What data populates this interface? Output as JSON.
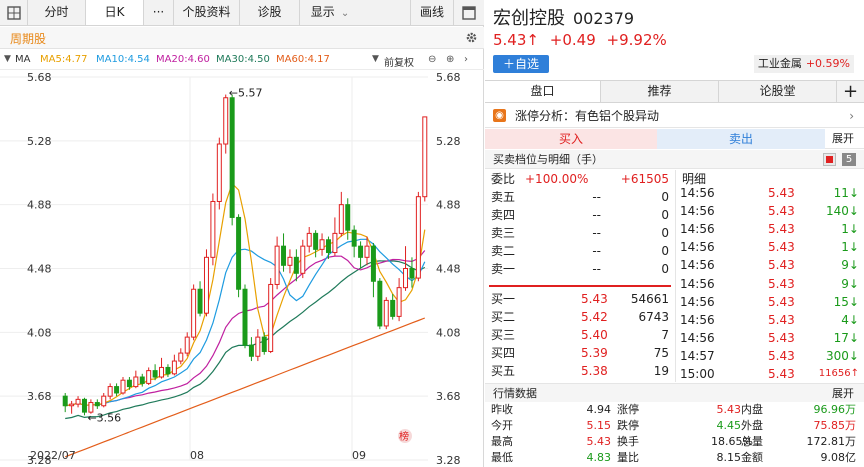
{
  "toolbar": {
    "fenshi": "分时",
    "rik": "日K",
    "more": "···",
    "ziliao": "个股资料",
    "zhengu": "诊股",
    "xianshi": "显示",
    "huaxian": "画线"
  },
  "subbar": {
    "zhouqi": "周期股"
  },
  "ma": {
    "label": "MA",
    "ma5": "MA5:4.77",
    "ma10": "MA10:4.54",
    "ma20": "MA20:4.60",
    "ma30": "MA30:4.50",
    "ma60": "MA60:4.17",
    "fuquan": "前复权"
  },
  "colors": {
    "up": "#e02020",
    "down": "#1a9a1a",
    "ma5": "#e8a000",
    "ma10": "#1e9be0",
    "ma20": "#c020a0",
    "ma30": "#1f7a5a",
    "ma60": "#e35d1a"
  },
  "chart_data": {
    "type": "candlestick",
    "y_ticks": [
      "5.68",
      "5.28",
      "4.88",
      "4.48",
      "4.08",
      "3.68",
      "3.28"
    ],
    "ylim": [
      3.28,
      5.68
    ],
    "x_labels": [
      "2022/07",
      "08",
      "09"
    ],
    "annotations": {
      "high": "←5.57",
      "low": "←3.56"
    },
    "candles": [
      [
        3.68,
        3.62,
        3.7,
        3.58
      ],
      [
        3.62,
        3.63,
        3.65,
        3.57
      ],
      [
        3.63,
        3.66,
        3.68,
        3.61
      ],
      [
        3.66,
        3.58,
        3.67,
        3.56
      ],
      [
        3.58,
        3.64,
        3.66,
        3.57
      ],
      [
        3.64,
        3.62,
        3.66,
        3.6
      ],
      [
        3.62,
        3.68,
        3.7,
        3.61
      ],
      [
        3.68,
        3.74,
        3.76,
        3.66
      ],
      [
        3.74,
        3.7,
        3.76,
        3.68
      ],
      [
        3.7,
        3.78,
        3.8,
        3.69
      ],
      [
        3.78,
        3.74,
        3.8,
        3.72
      ],
      [
        3.74,
        3.8,
        3.84,
        3.73
      ],
      [
        3.8,
        3.76,
        3.82,
        3.74
      ],
      [
        3.76,
        3.84,
        3.86,
        3.75
      ],
      [
        3.84,
        3.8,
        3.88,
        3.78
      ],
      [
        3.8,
        3.86,
        3.92,
        3.79
      ],
      [
        3.86,
        3.82,
        3.88,
        3.8
      ],
      [
        3.82,
        3.9,
        3.94,
        3.81
      ],
      [
        3.9,
        3.95,
        3.98,
        3.88
      ],
      [
        3.95,
        4.05,
        4.08,
        3.93
      ],
      [
        4.05,
        4.35,
        4.38,
        4.03
      ],
      [
        4.35,
        4.2,
        4.4,
        4.18
      ],
      [
        4.2,
        4.55,
        4.6,
        4.18
      ],
      [
        4.55,
        4.9,
        4.95,
        4.5
      ],
      [
        4.9,
        5.26,
        5.3,
        4.85
      ],
      [
        5.26,
        5.55,
        5.57,
        5.2
      ],
      [
        5.55,
        4.8,
        5.57,
        4.75
      ],
      [
        4.8,
        4.35,
        4.82,
        4.3
      ],
      [
        4.35,
        4.0,
        4.38,
        3.98
      ],
      [
        4.0,
        3.93,
        4.05,
        3.9
      ],
      [
        3.93,
        4.05,
        4.1,
        3.9
      ],
      [
        4.05,
        3.96,
        4.08,
        3.94
      ],
      [
        3.96,
        4.38,
        4.42,
        3.95
      ],
      [
        4.38,
        4.62,
        4.68,
        4.35
      ],
      [
        4.62,
        4.5,
        4.7,
        4.46
      ],
      [
        4.5,
        4.55,
        4.6,
        4.45
      ],
      [
        4.55,
        4.45,
        4.6,
        4.4
      ],
      [
        4.45,
        4.62,
        4.66,
        4.42
      ],
      [
        4.62,
        4.7,
        4.74,
        4.58
      ],
      [
        4.7,
        4.6,
        4.72,
        4.55
      ],
      [
        4.6,
        4.66,
        4.7,
        4.56
      ],
      [
        4.66,
        4.58,
        4.68,
        4.54
      ],
      [
        4.58,
        4.7,
        4.8,
        4.56
      ],
      [
        4.7,
        4.88,
        4.96,
        4.68
      ],
      [
        4.88,
        4.72,
        4.92,
        4.66
      ],
      [
        4.72,
        4.62,
        4.75,
        4.55
      ],
      [
        4.62,
        4.55,
        4.65,
        4.48
      ],
      [
        4.55,
        4.62,
        4.68,
        4.5
      ],
      [
        4.62,
        4.4,
        4.64,
        4.3
      ],
      [
        4.4,
        4.12,
        4.42,
        4.1
      ],
      [
        4.12,
        4.28,
        4.3,
        4.1
      ],
      [
        4.28,
        4.18,
        4.32,
        4.16
      ],
      [
        4.18,
        4.36,
        4.42,
        4.15
      ],
      [
        4.36,
        4.48,
        4.62,
        4.34
      ],
      [
        4.48,
        4.42,
        4.55,
        4.36
      ],
      [
        4.42,
        4.93,
        4.96,
        4.4
      ],
      [
        4.93,
        5.43,
        5.43,
        4.9
      ]
    ]
  },
  "stock": {
    "name": "宏创控股",
    "code": "002379",
    "price": "5.43",
    "arrow": "↑",
    "change": "+0.49",
    "pct": "+9.92%",
    "add_btn": "＋自选",
    "industry": "工业金属",
    "industry_pct": "+0.59%"
  },
  "tabs": {
    "pankou": "盘口",
    "tuijian": "推荐",
    "luntang": "论股堂",
    "plus": "+"
  },
  "news": {
    "text": "涨停分析：有色铝个股异动"
  },
  "bs": {
    "buy": "买入",
    "sell": "卖出",
    "expand": "展开"
  },
  "detail": {
    "title": "买卖档位与明细（手）",
    "badge": "5"
  },
  "orderbook": {
    "weibi_label": "委比",
    "weibi": "+100.00%",
    "weicha": "+61505",
    "asks": [
      {
        "l": "卖五",
        "p": "--",
        "v": "0"
      },
      {
        "l": "卖四",
        "p": "--",
        "v": "0"
      },
      {
        "l": "卖三",
        "p": "--",
        "v": "0"
      },
      {
        "l": "卖二",
        "p": "--",
        "v": "0"
      },
      {
        "l": "卖一",
        "p": "--",
        "v": "0"
      }
    ],
    "bids": [
      {
        "l": "买一",
        "p": "5.43",
        "v": "54661"
      },
      {
        "l": "买二",
        "p": "5.42",
        "v": "6743"
      },
      {
        "l": "买三",
        "p": "5.40",
        "v": "7"
      },
      {
        "l": "买四",
        "p": "5.39",
        "v": "75"
      },
      {
        "l": "买五",
        "p": "5.38",
        "v": "19"
      }
    ]
  },
  "mingxi": {
    "label": "明细",
    "rows": [
      {
        "t": "14:56",
        "p": "5.43",
        "v": "11↓"
      },
      {
        "t": "14:56",
        "p": "5.43",
        "v": "140↓"
      },
      {
        "t": "14:56",
        "p": "5.43",
        "v": "1↓"
      },
      {
        "t": "14:56",
        "p": "5.43",
        "v": "1↓"
      },
      {
        "t": "14:56",
        "p": "5.43",
        "v": "9↓"
      },
      {
        "t": "14:56",
        "p": "5.43",
        "v": "9↓"
      },
      {
        "t": "14:56",
        "p": "5.43",
        "v": "15↓"
      },
      {
        "t": "14:56",
        "p": "5.43",
        "v": "4↓"
      },
      {
        "t": "14:56",
        "p": "5.43",
        "v": "17↓"
      },
      {
        "t": "14:57",
        "p": "5.43",
        "v": "300↓"
      },
      {
        "t": "15:00",
        "p": "5.43",
        "v": "11656↑"
      }
    ]
  },
  "quote": {
    "title": "行情数据",
    "expand": "展开",
    "rows": [
      [
        {
          "l": "昨收",
          "v": "4.94",
          "c": ""
        },
        {
          "l": "涨停",
          "v": "5.43",
          "c": "red"
        },
        {
          "l": "内盘",
          "v": "96.96万",
          "c": "grn"
        }
      ],
      [
        {
          "l": "今开",
          "v": "5.15",
          "c": "red"
        },
        {
          "l": "跌停",
          "v": "4.45",
          "c": "grn"
        },
        {
          "l": "外盘",
          "v": "75.85万",
          "c": "red"
        }
      ],
      [
        {
          "l": "最高",
          "v": "5.43",
          "c": "red"
        },
        {
          "l": "换手",
          "v": "18.65%",
          "c": ""
        },
        {
          "l": "总量",
          "v": "172.81万",
          "c": ""
        }
      ],
      [
        {
          "l": "最低",
          "v": "4.83",
          "c": "grn"
        },
        {
          "l": "量比",
          "v": "8.15",
          "c": ""
        },
        {
          "l": "金额",
          "v": "9.08亿",
          "c": ""
        }
      ]
    ]
  }
}
